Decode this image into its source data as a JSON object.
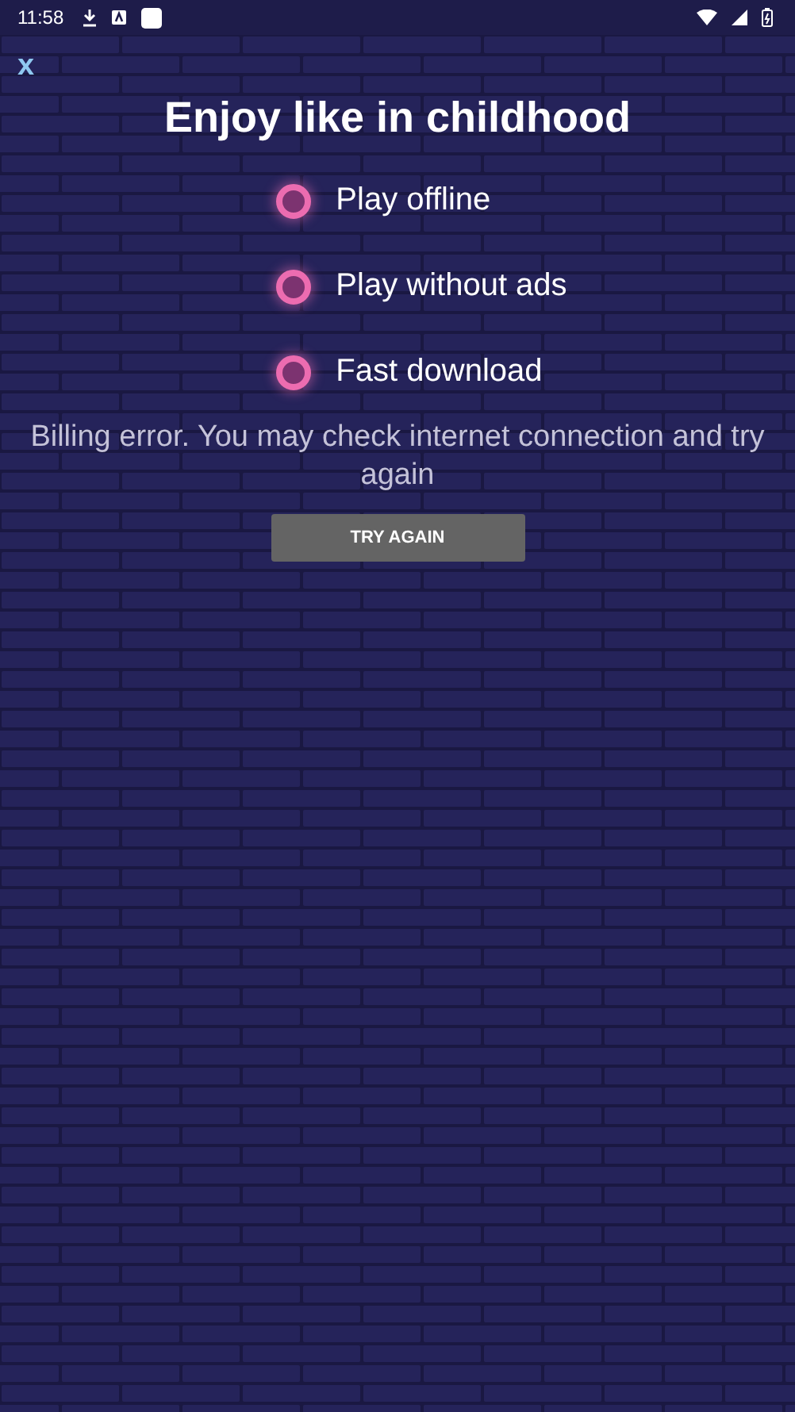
{
  "status_bar": {
    "time": "11:58"
  },
  "close": {
    "label": "x"
  },
  "title": "Enjoy like in childhood",
  "features": [
    {
      "label": "Play offline"
    },
    {
      "label": "Play without ads"
    },
    {
      "label": "Fast download"
    }
  ],
  "message": "Billing error. You may check internet connection and try again",
  "button": {
    "label": "TRY AGAIN"
  }
}
